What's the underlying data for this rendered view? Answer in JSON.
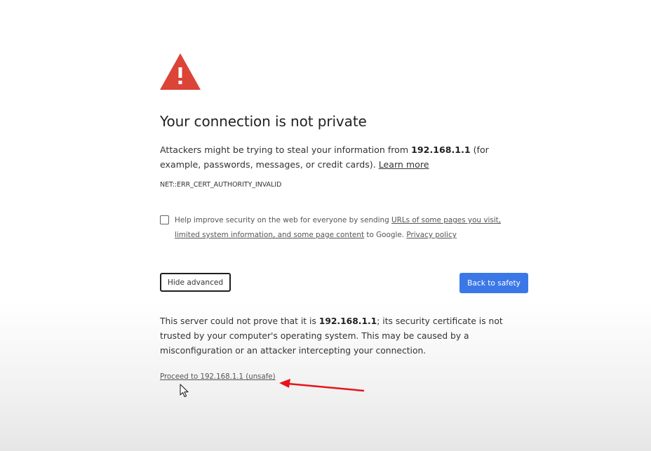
{
  "interstitial": {
    "icon": "warning-triangle-icon",
    "title": "Your connection is not private",
    "message": {
      "prefix": "Attackers might be trying to steal your information from ",
      "host": "192.168.1.1",
      "suffix": " (for example, passwords, messages, or credit cards). ",
      "learn_more": "Learn more"
    },
    "error_code": "NET::ERR_CERT_AUTHORITY_INVALID",
    "opt_in": {
      "text_before": "Help improve security on the web for everyone by sending ",
      "link": "URLs of some pages you visit, limited system information, and some page content",
      "text_after": " to Google. ",
      "privacy_link": "Privacy policy",
      "checked": false
    },
    "buttons": {
      "hide_advanced": "Hide advanced",
      "back_to_safety": "Back to safety"
    },
    "advanced": {
      "prefix": "This server could not prove that it is ",
      "host": "192.168.1.1",
      "suffix": "; its security certificate is not trusted by your computer's operating system. This may be caused by a misconfiguration or an attacker intercepting your connection."
    },
    "proceed_link": "Proceed to 192.168.1.1 (unsafe)"
  },
  "colors": {
    "warning_red": "#db4437",
    "primary_blue": "#3b78e7",
    "annotation_red": "#e8141b"
  },
  "overlay": {
    "annotation": "red-arrow-icon",
    "cursor": "mouse-pointer-icon"
  }
}
